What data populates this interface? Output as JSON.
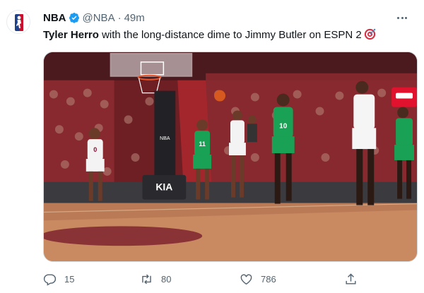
{
  "tweet": {
    "display_name": "NBA",
    "handle": "@NBA",
    "separator": "·",
    "time": "49m",
    "text_name": "Tyler Herro",
    "text_rest": " with the long-distance dime to Jimmy Butler on ESPN 2",
    "text_emoji": "direct-hit-target-emoji"
  },
  "media": {
    "scoreboard_logo": "NBA",
    "sponsor": "KIA",
    "jersey_numbers": [
      "0",
      "11",
      "10"
    ]
  },
  "actions": {
    "reply_count": "15",
    "retweet_count": "80",
    "like_count": "786"
  },
  "colors": {
    "verified_blue": "#1d9bf0",
    "text_primary": "#0f1419",
    "text_secondary": "#536471",
    "heat_red": "#98002e",
    "celtics_green": "#007a33"
  },
  "icons": [
    "nba-logo-icon",
    "verified-badge-icon",
    "more-options-icon",
    "reply-icon",
    "retweet-icon",
    "like-icon",
    "share-icon"
  ]
}
